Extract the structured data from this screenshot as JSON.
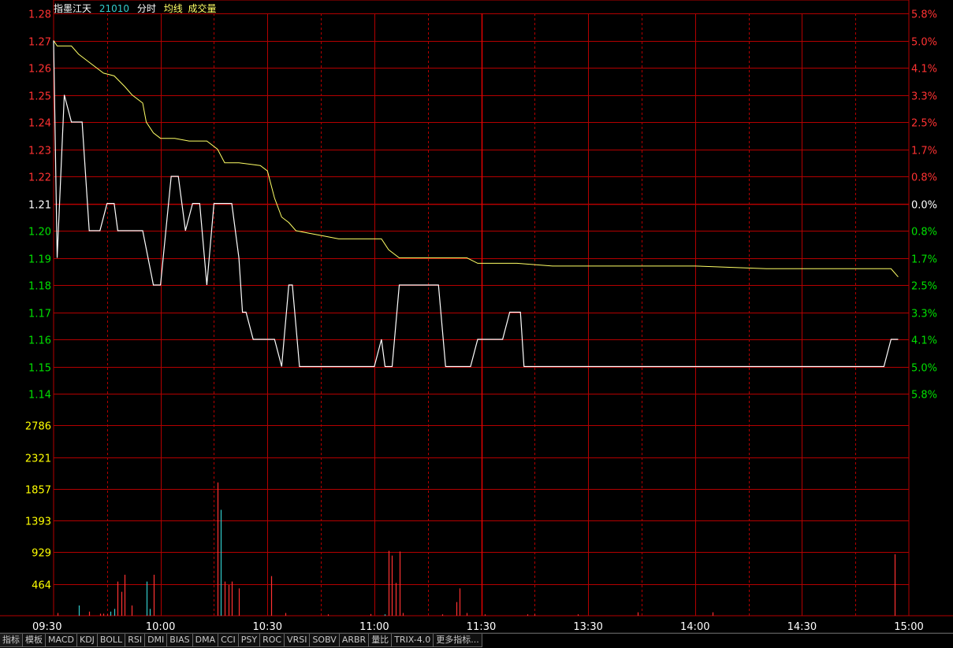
{
  "header": {
    "stock_name": "指墨江天",
    "code": "21010",
    "labels": [
      "分时",
      "均线",
      "成交量"
    ]
  },
  "colors": {
    "grid": "#b40000",
    "grid_dashed": "#8c0000",
    "up": "#ff3232",
    "down": "#00e000",
    "flat": "#ffffff",
    "price_line": "#ffffff",
    "avg_line": "#ffff66",
    "vol_up": "#ff3232",
    "vol_down": "#33cccc",
    "vol_axis": "#ffff00"
  },
  "chart_data": {
    "type": "line",
    "price_axis": {
      "ylim": [
        1.14,
        1.28
      ],
      "prev_close": 1.21,
      "ticks": [
        "1.28",
        "1.27",
        "1.26",
        "1.25",
        "1.24",
        "1.23",
        "1.22",
        "1.21",
        "1.20",
        "1.19",
        "1.18",
        "1.17",
        "1.16",
        "1.15",
        "1.14"
      ]
    },
    "pct_ticks": [
      "5.8%",
      "5.0%",
      "4.1%",
      "3.3%",
      "2.5%",
      "1.7%",
      "0.8%",
      "0.0%",
      "0.8%",
      "1.7%",
      "2.5%",
      "3.3%",
      "4.1%",
      "5.0%",
      "5.8%"
    ],
    "volume_axis": {
      "ylim": [
        0,
        3250
      ],
      "ticks": [
        "2786",
        "2321",
        "1857",
        "1393",
        "929",
        "464"
      ]
    },
    "time_ticks": [
      "09:30",
      "10:00",
      "10:30",
      "11:00",
      "11:30",
      "13:30",
      "14:00",
      "14:30",
      "15:00"
    ],
    "price_series": {
      "name": "分时",
      "points": [
        [
          0,
          1.27
        ],
        [
          1,
          1.19
        ],
        [
          3,
          1.25
        ],
        [
          5,
          1.24
        ],
        [
          8,
          1.24
        ],
        [
          10,
          1.2
        ],
        [
          13,
          1.2
        ],
        [
          15,
          1.21
        ],
        [
          17,
          1.21
        ],
        [
          18,
          1.2
        ],
        [
          22,
          1.2
        ],
        [
          25,
          1.2
        ],
        [
          28,
          1.18
        ],
        [
          30,
          1.18
        ],
        [
          33,
          1.22
        ],
        [
          35,
          1.22
        ],
        [
          37,
          1.2
        ],
        [
          39,
          1.21
        ],
        [
          41,
          1.21
        ],
        [
          43,
          1.18
        ],
        [
          45,
          1.21
        ],
        [
          50,
          1.21
        ],
        [
          52,
          1.19
        ],
        [
          53,
          1.17
        ],
        [
          54,
          1.17
        ],
        [
          56,
          1.16
        ],
        [
          62,
          1.16
        ],
        [
          64,
          1.15
        ],
        [
          66,
          1.18
        ],
        [
          67,
          1.18
        ],
        [
          69,
          1.15
        ],
        [
          90,
          1.15
        ],
        [
          92,
          1.16
        ],
        [
          93,
          1.15
        ],
        [
          95,
          1.15
        ],
        [
          97,
          1.18
        ],
        [
          108,
          1.18
        ],
        [
          110,
          1.15
        ],
        [
          117,
          1.15
        ],
        [
          119,
          1.16
        ],
        [
          126,
          1.16
        ],
        [
          128,
          1.17
        ],
        [
          131,
          1.17
        ],
        [
          132,
          1.15
        ],
        [
          150,
          1.15
        ],
        [
          170,
          1.15
        ],
        [
          200,
          1.15
        ],
        [
          210,
          1.15
        ],
        [
          233,
          1.15
        ],
        [
          235,
          1.16
        ],
        [
          237,
          1.16
        ]
      ]
    },
    "avg_series": {
      "name": "均线",
      "points": [
        [
          0,
          1.27
        ],
        [
          1,
          1.268
        ],
        [
          5,
          1.268
        ],
        [
          7,
          1.265
        ],
        [
          10,
          1.262
        ],
        [
          14,
          1.258
        ],
        [
          17,
          1.257
        ],
        [
          20,
          1.253
        ],
        [
          22,
          1.25
        ],
        [
          25,
          1.247
        ],
        [
          26,
          1.24
        ],
        [
          28,
          1.236
        ],
        [
          30,
          1.234
        ],
        [
          34,
          1.234
        ],
        [
          38,
          1.233
        ],
        [
          43,
          1.233
        ],
        [
          46,
          1.23
        ],
        [
          48,
          1.225
        ],
        [
          52,
          1.225
        ],
        [
          58,
          1.224
        ],
        [
          60,
          1.222
        ],
        [
          62,
          1.212
        ],
        [
          64,
          1.205
        ],
        [
          66,
          1.203
        ],
        [
          68,
          1.2
        ],
        [
          72,
          1.199
        ],
        [
          76,
          1.198
        ],
        [
          80,
          1.197
        ],
        [
          88,
          1.197
        ],
        [
          92,
          1.197
        ],
        [
          94,
          1.193
        ],
        [
          97,
          1.19
        ],
        [
          110,
          1.19
        ],
        [
          116,
          1.19
        ],
        [
          119,
          1.188
        ],
        [
          130,
          1.188
        ],
        [
          140,
          1.187
        ],
        [
          160,
          1.187
        ],
        [
          180,
          1.187
        ],
        [
          200,
          1.186
        ],
        [
          220,
          1.186
        ],
        [
          235,
          1.186
        ],
        [
          237,
          1.183
        ]
      ]
    },
    "volume_series": {
      "name": "成交量",
      "bars": [
        [
          1,
          40,
          "up"
        ],
        [
          7,
          150,
          "down"
        ],
        [
          10,
          60,
          "up"
        ],
        [
          13,
          30,
          "up"
        ],
        [
          14,
          30,
          "up"
        ],
        [
          15,
          20,
          "up"
        ],
        [
          16,
          60,
          "down"
        ],
        [
          17,
          100,
          "down"
        ],
        [
          18,
          500,
          "up"
        ],
        [
          19,
          350,
          "up"
        ],
        [
          20,
          600,
          "up"
        ],
        [
          22,
          150,
          "up"
        ],
        [
          26,
          500,
          "down"
        ],
        [
          27,
          100,
          "down"
        ],
        [
          28,
          600,
          "up"
        ],
        [
          46,
          1950,
          "up"
        ],
        [
          47,
          1550,
          "down"
        ],
        [
          48,
          500,
          "up"
        ],
        [
          49,
          450,
          "up"
        ],
        [
          50,
          500,
          "up"
        ],
        [
          52,
          400,
          "up"
        ],
        [
          61,
          580,
          "up"
        ],
        [
          65,
          40,
          "up"
        ],
        [
          77,
          20,
          "up"
        ],
        [
          89,
          25,
          "up"
        ],
        [
          93,
          20,
          "down"
        ],
        [
          94,
          950,
          "up"
        ],
        [
          95,
          880,
          "up"
        ],
        [
          96,
          480,
          "up"
        ],
        [
          97,
          940,
          "up"
        ],
        [
          98,
          40,
          "up"
        ],
        [
          109,
          20,
          "up"
        ],
        [
          113,
          200,
          "up"
        ],
        [
          114,
          400,
          "up"
        ],
        [
          116,
          40,
          "up"
        ],
        [
          121,
          20,
          "up"
        ],
        [
          133,
          20,
          "up"
        ],
        [
          135,
          20,
          "up"
        ],
        [
          147,
          20,
          "up"
        ],
        [
          164,
          50,
          "up"
        ],
        [
          185,
          50,
          "up"
        ],
        [
          236,
          900,
          "up"
        ]
      ]
    }
  },
  "toolbar": {
    "tabs": [
      "指标",
      "模板",
      "MACD",
      "KDJ",
      "BOLL",
      "RSI",
      "DMI",
      "BIAS",
      "DMA",
      "CCI",
      "PSY",
      "ROC",
      "VRSI",
      "SOBV",
      "ARBR",
      "量比",
      "TRIX-4.0",
      "更多指标..."
    ]
  }
}
